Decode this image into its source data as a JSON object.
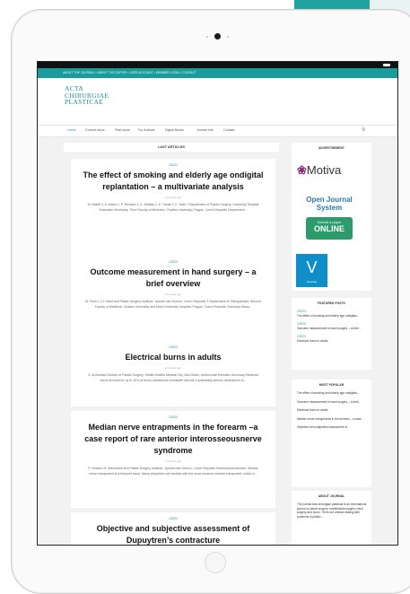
{
  "top_links": "ABOUT THE JOURNAL  •  ABOUT THE EDITOR  •  USER ACCOUNT  •  MEMBER LOGIN  •  CONTACT",
  "site": {
    "logo_lines": [
      "ACTA",
      "CHIRURGIAE",
      "PLASTICAE"
    ]
  },
  "nav": {
    "items": [
      "Home",
      "Current Issue",
      "Past Issue",
      "For Authors",
      "Digital Books",
      "Journal Info",
      "Contact"
    ],
    "active": "Home"
  },
  "main": {
    "section_title": "LAST ARTICLES",
    "articles": [
      {
        "date": "2/2023",
        "title": "The effect of smoking and elderly age ondigital replantation – a multivariate analysis",
        "ago": "3 months ago",
        "excerpt": "M. Maleff 1, A. Adam 1, P. Reckard 1, A. Whitley 1, K. Horak 2, K. Nark 1 Department of Plastic Surgery, University Hospital Kralovske Vinohrady, Third Faculty of Medicine, Charles University, Prague, Czech Republic Department..."
      },
      {
        "date": "2/2023",
        "title": "Outcome measurement in hand surgery – a brief overview",
        "ago": "3 months ago",
        "excerpt": "M. Pauli 1,2 1 Hand and Plastic Surgery Institute, Vysoké nad Jizerou, Czech Republic 2 Department of Orthopaedics, Second Faculty of Medicine, Charles University and Motol University Hospital, Prague, Czech Republic Summary Many..."
      },
      {
        "date": "2/2023",
        "title": "Electrical burns in adults",
        "ago": "3 months ago",
        "excerpt": "S. Al Barrawi Division of Plastic Surgery, Sheikh Khalifa Medical City, Abu Dhabi, United Arab Emirates Summary Electrical burns account for up to 10% of burns admissions worldwide and are a potentially serious mechanism of..."
      },
      {
        "date": "2/2023",
        "title": "Median nerve entrapments in the forearm –a case report of rare anterior interosseousnerve syndrome",
        "ago": "3 months ago",
        "excerpt": "P. Hrnidra, M. Machhand and Plastic Surgery Institute, Vysoké nad Jizerou, Czech Republic SummaryIntroduction. Median nerve entrapment is a frequent issue. Many physicians are familiar with the most common median entrapment, which is..."
      },
      {
        "date": "2/2023",
        "title": "Objective and subjective assessment of Dupuytren’s contracture",
        "ago": "",
        "excerpt": ""
      }
    ]
  },
  "sidebar": {
    "advertisement_title": "ADVERTISEMENT",
    "motiva_text": "Motiva",
    "ojs_title": "Open Journal System",
    "ojs_button_small": "Submit a paper",
    "ojs_button_big": "ONLINE",
    "badge_letter": "V",
    "badge_small": "Vinohrady",
    "featured_title": "FEATURED POSTS",
    "featured": [
      {
        "date": "2/2023",
        "text": "The effect of smoking and elderly age ondigitas..."
      },
      {
        "date": "2/2023",
        "text": "Outcome measurement in hand surgery – a brief..."
      },
      {
        "date": "2/2023",
        "text": "Electrical burns in adults"
      }
    ],
    "popular_title": "MOST POPULAR",
    "popular": [
      "The effect of smoking and elderly age ondigitas...",
      "Outcome measurement in hand surgery – a brief...",
      "Electrical burns in adults",
      "Median nerve entrapments in the forearm – a case...",
      "Objective and subjective assessment of..."
    ],
    "about_title": "ABOUT JOURNAL",
    "about_text": "The journal Acta chirurgiae plasticae is an international journal of plastic surgery, maxillofacial surgery, hand surgery and burns. There are articles dealing with problems of plastic..."
  },
  "colors": {
    "accent": "#1b9c9a",
    "ad_brand": "#8a2c7c",
    "ojs_button": "#2c9a6a",
    "badge": "#0f8ec9"
  }
}
